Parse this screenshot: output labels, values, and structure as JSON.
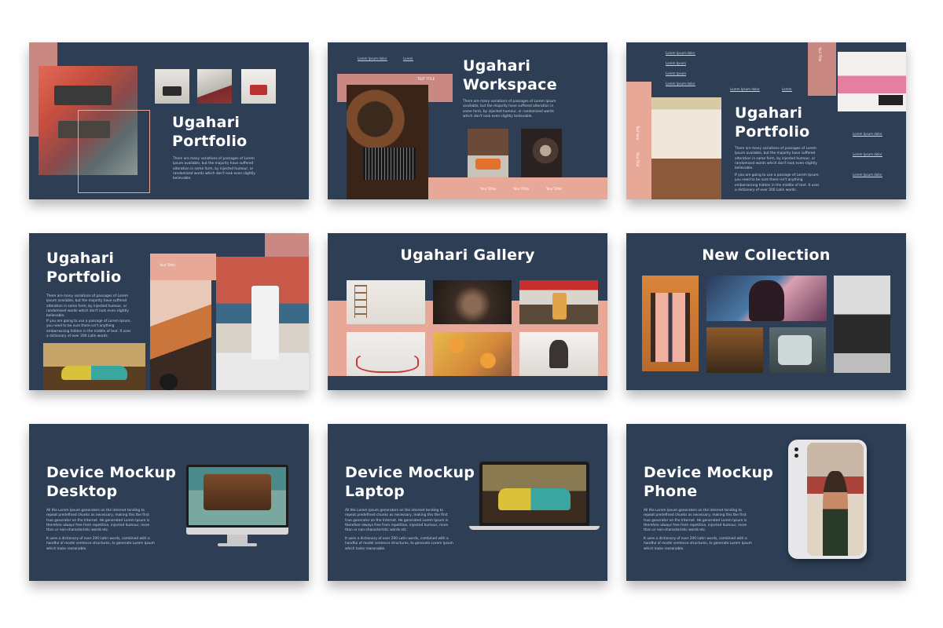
{
  "palette": {
    "navy": "#2d3e55",
    "peach": "#e8a898",
    "rose": "#c98882",
    "text": "#ffffff"
  },
  "slides": {
    "s1": {
      "title": "Ugahari\nPortfolio",
      "body": "There are many variations of passages of Lorem Ipsum available, but the majority have suffered alteration in some form, by injected humour, or randomised words which don't look even slightly believable."
    },
    "s2": {
      "nav_left": "Lorem Ipsum dolor",
      "nav_right": "Lorem",
      "tag": "TEXT TITLE",
      "title": "Ugahari\nWorkspace",
      "body": "There are many variations of passages of Lorem Ipsum available, but the majority have suffered alteration in some form, by injected humour, or randomised words which don't look even slightly believable.",
      "cap_left": "Your Tittle",
      "cap_mid": "Your Tittle",
      "cap_right": "Your Tittle"
    },
    "s3": {
      "nav1": "Lorem Ipsum dolor",
      "nav2": "Lorem Ipsum",
      "nav3": "Lorem Ipsum",
      "nav4": "Lorem Ipsum dolor",
      "nav5": "Lorem",
      "side_right_a": "Lorem Ipsum dolor",
      "side_right_b": "Lorem Ipsum dolor",
      "side_right_c": "Lorem Ipsum dolor",
      "vertical_a": "Your Title",
      "vertical_b": "Text here",
      "vertical_c": "Your Title",
      "title": "Ugahari\nPortfolio",
      "body1": "There are many variations of passages of Lorem Ipsum available, but the majority have suffered alteration in some form, by injected humour, or randomised words which don't look even slightly believable.",
      "body2": "If you are going to use a passage of Lorem Ipsum, you need to be sure there isn't anything embarrassing hidden in the middle of text. It uses a dictionary of over 200 Latin words."
    },
    "s4": {
      "title": "Ugahari\nPortfolio",
      "tag": "Your Tittle",
      "body1": "There are many variations of passages of Lorem Ipsum available, but the majority have suffered alteration in some form, by injected humour, or randomised words which don't look even slightly believable.",
      "body2": "If you are going to use a passage of Lorem Ipsum, you need to be sure there isn't anything embarrassing hidden in the middle of text. It uses a dictionary of over 200 Latin words."
    },
    "s5": {
      "title": "Ugahari Gallery"
    },
    "s6": {
      "title": "New Collection"
    },
    "s7": {
      "title": "Device Mockup\nDesktop",
      "body1": "All the Lorem Ipsum generators on the Internet tending to repeat predefined chunks as necessary, making this the first true generator on the Internet. He generated Lorem Ipsum is therefore always free from repetition, injected humour, more than or non-characteristic words etc.",
      "body2": "It uses a dictionary of over 200 Latin words, combined with a handful of model sentence structures, to generate Lorem Ipsum which looks reasonable."
    },
    "s8": {
      "title": "Device Mockup\nLaptop",
      "body1": "All the Lorem Ipsum generators on the Internet tending to repeat predefined chunks as necessary, making this the first true generator on the Internet. He generated Lorem Ipsum is therefore always free from repetition, injected humour, more than or non-characteristic words etc.",
      "body2": "It uses a dictionary of over 200 Latin words, combined with a handful of model sentence structures, to generate Lorem Ipsum which looks reasonable."
    },
    "s9": {
      "title": "Device Mockup\nPhone",
      "body1": "All the Lorem Ipsum generators on the Internet tending to repeat predefined chunks as necessary, making this the first true generator on the Internet. He generated Lorem Ipsum is therefore always free from repetition, injected humour, more than or non-characteristic words etc.",
      "body2": "It uses a dictionary of over 200 Latin words, combined with a handful of model sentence structures, to generate Lorem Ipsum which looks reasonable."
    }
  }
}
